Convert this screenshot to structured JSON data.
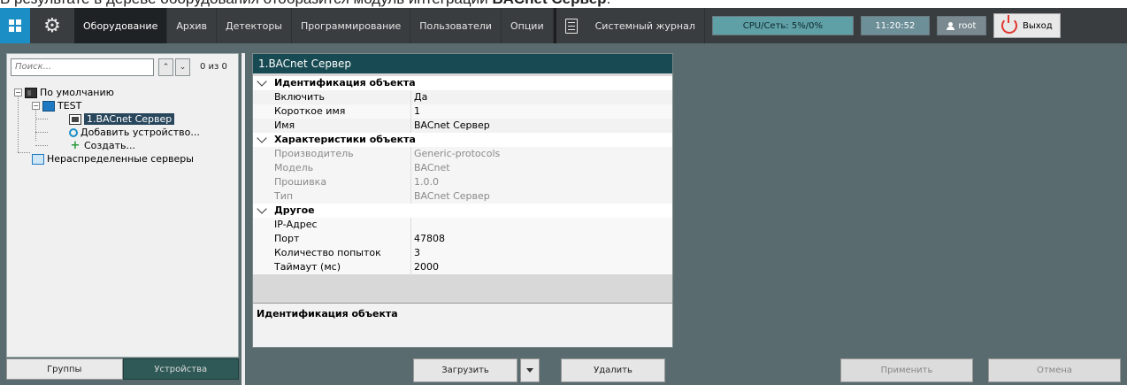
{
  "caption": {
    "prefix": "В результате в дереве оборудования отобразится модуль интеграции ",
    "bold": "BACnet Сервер",
    "suffix": "."
  },
  "topbar": {
    "tabs": [
      {
        "label": "Оборудование",
        "active": true
      },
      {
        "label": "Архив"
      },
      {
        "label": "Детекторы"
      },
      {
        "label": "Программирование"
      },
      {
        "label": "Пользователи"
      },
      {
        "label": "Опции"
      }
    ],
    "journal_label": "Системный журнал",
    "cpu_label": "CPU/Сеть: 5%/0%",
    "clock": "11:20:52",
    "user": "root",
    "logout_label": "Выход",
    "accent": "#1b8ec6"
  },
  "left": {
    "search_placeholder": "Поиск...",
    "counter": "0 из 0",
    "tree": {
      "root": "По умолчанию",
      "domain": "TEST",
      "server": "1.BACnet Сервер",
      "add_device": "Добавить устройство...",
      "create": "Создать...",
      "unassigned": "Нераспределенные серверы"
    },
    "groups_label": "Группы",
    "devices_label": "Устройства"
  },
  "props": {
    "title": "1.BACnet Сервер",
    "sections": {
      "identification": "Идентификация объекта",
      "characteristics": "Характеристики объекта",
      "other": "Другое"
    },
    "rows": {
      "enable": {
        "k": "Включить",
        "v": "Да"
      },
      "short_name": {
        "k": "Короткое имя",
        "v": "1"
      },
      "name": {
        "k": "Имя",
        "v": "BACnet Сервер"
      },
      "vendor": {
        "k": "Производитель",
        "v": "Generic-protocols"
      },
      "model": {
        "k": "Модель",
        "v": "BACnet"
      },
      "firmware": {
        "k": "Прошивка",
        "v": "1.0.0"
      },
      "type": {
        "k": "Тип",
        "v": "BACnet Сервер"
      },
      "ip": {
        "k": "IP-Адрес",
        "v": ""
      },
      "port": {
        "k": "Порт",
        "v": "47808"
      },
      "retries": {
        "k": "Количество попыток",
        "v": "3"
      },
      "timeout": {
        "k": "Таймаут (мс)",
        "v": "2000"
      }
    },
    "description_title": "Идентификация объекта"
  },
  "buttons": {
    "load": "Загрузить",
    "delete": "Удалить",
    "apply": "Применить",
    "cancel": "Отмена"
  }
}
